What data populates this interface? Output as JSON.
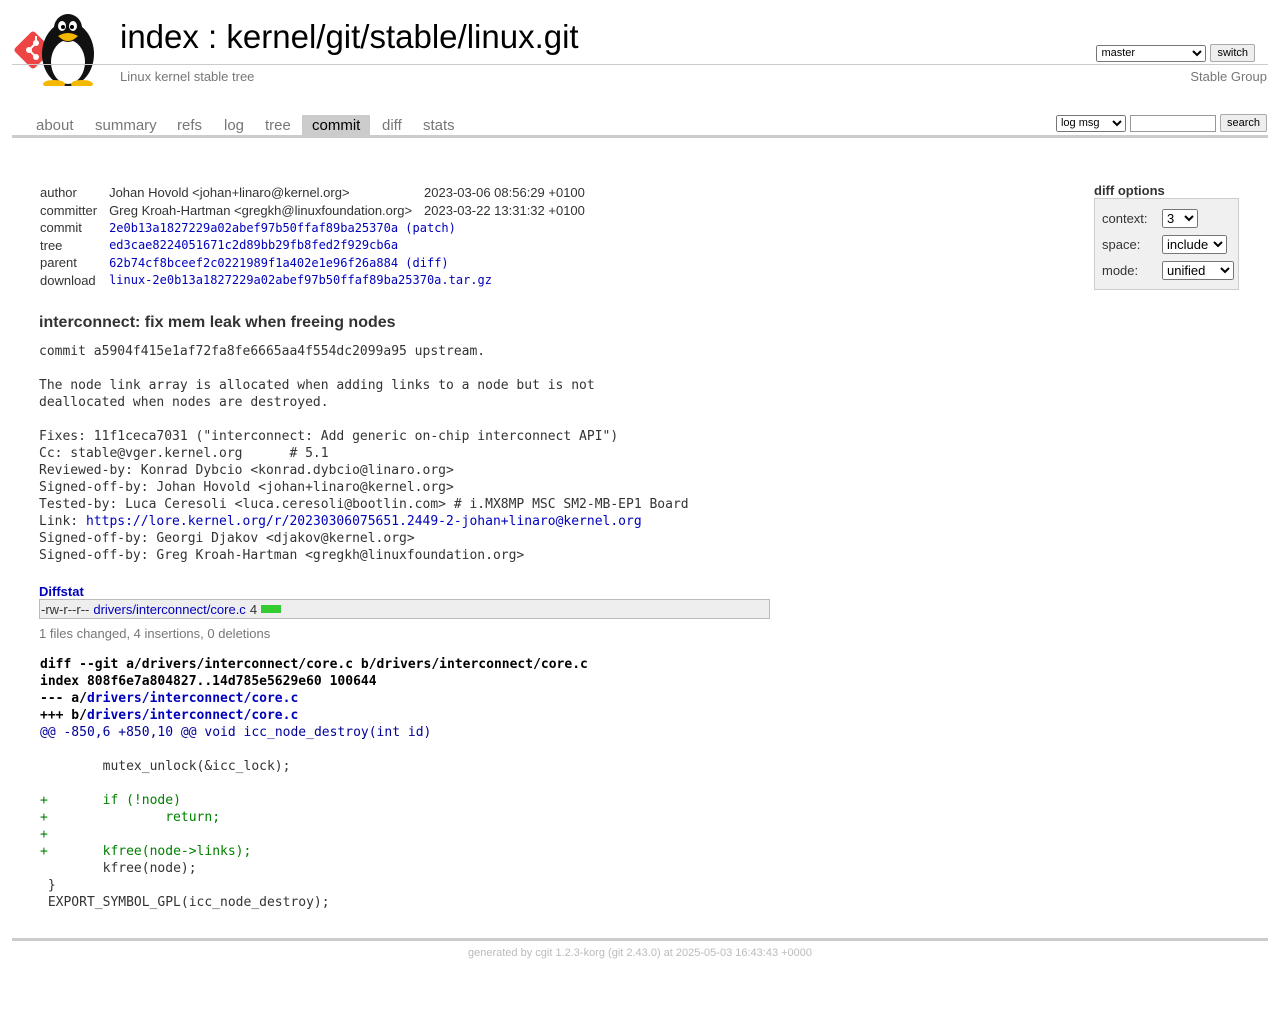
{
  "header": {
    "title_prefix": "index",
    "title_separator": " : ",
    "title_repo": "kernel/git/stable/linux.git",
    "subtitle": "Linux kernel stable tree",
    "owner": "Stable Group",
    "branch_selected": "master",
    "switch_label": "switch"
  },
  "tabs": [
    "about",
    "summary",
    "refs",
    "log",
    "tree",
    "commit",
    "diff",
    "stats"
  ],
  "active_tab": "commit",
  "search": {
    "mode": "log msg",
    "button": "search"
  },
  "commit_info": {
    "author_label": "author",
    "author": "Johan Hovold <johan+linaro@kernel.org>",
    "author_date": "2023-03-06 08:56:29 +0100",
    "committer_label": "committer",
    "committer": "Greg Kroah-Hartman <gregkh@linuxfoundation.org>",
    "committer_date": "2023-03-22 13:31:32 +0100",
    "commit_label": "commit",
    "commit": "2e0b13a1827229a02abef97b50ffaf89ba25370a",
    "patch_label": "patch",
    "tree_label": "tree",
    "tree": "ed3cae8224051671c2d89bb29fb8fed2f929cb6a",
    "parent_label": "parent",
    "parent": "62b74cf8bceef2c0221989f1a402e1e96f26a884",
    "diff_label": "diff",
    "download_label": "download",
    "download": "linux-2e0b13a1827229a02abef97b50ffaf89ba25370a.tar.gz"
  },
  "diff_options": {
    "title": "diff options",
    "context_label": "context:",
    "context_value": "3",
    "space_label": "space:",
    "space_value": "include",
    "mode_label": "mode:",
    "mode_value": "unified"
  },
  "commit_subject": "interconnect: fix mem leak when freeing nodes",
  "commit_message": {
    "body_before_link": "commit a5904f415e1af72fa8fe6665aa4f554dc2099a95 upstream.\n\nThe node link array is allocated when adding links to a node but is not\ndeallocated when nodes are destroyed.\n\nFixes: 11f1ceca7031 (\"interconnect: Add generic on-chip interconnect API\")\nCc: stable@vger.kernel.org      # 5.1\nReviewed-by: Konrad Dybcio <konrad.dybcio@linaro.org>\nSigned-off-by: Johan Hovold <johan+linaro@kernel.org>\nTested-by: Luca Ceresoli <luca.ceresoli@bootlin.com> # i.MX8MP MSC SM2-MB-EP1 Board\nLink: ",
    "link": "https://lore.kernel.org/r/20230306075651.2449-2-johan+linaro@kernel.org",
    "body_after_link": "\nSigned-off-by: Georgi Djakov <djakov@kernel.org>\nSigned-off-by: Greg Kroah-Hartman <gregkh@linuxfoundation.org>"
  },
  "diffstat": {
    "header": "Diffstat",
    "mode": "-rw-r--r--",
    "file": "drivers/interconnect/core.c",
    "count": "4",
    "summary": "1 files changed, 4 insertions, 0 deletions"
  },
  "diff": {
    "line1": "diff --git a/drivers/interconnect/core.c b/drivers/interconnect/core.c",
    "line2": "index 808f6e7a804827..14d785e5629e60 100644",
    "line3_prefix": "--- a/",
    "line3_file": "drivers/interconnect/core.c",
    "line4_prefix": "+++ b/",
    "line4_file": "drivers/interconnect/core.c",
    "hunk_header": "@@ -850,6 +850,10 @@",
    "hunk_context": " void icc_node_destroy(int id)",
    "lines": [
      {
        "type": "ctx",
        "text": " "
      },
      {
        "type": "ctx",
        "text": " \tmutex_unlock(&icc_lock);"
      },
      {
        "type": "ctx",
        "text": " "
      },
      {
        "type": "add",
        "text": "+\tif (!node)"
      },
      {
        "type": "add",
        "text": "+\t\treturn;"
      },
      {
        "type": "add",
        "text": "+"
      },
      {
        "type": "add",
        "text": "+\tkfree(node->links);"
      },
      {
        "type": "ctx",
        "text": " \tkfree(node);"
      },
      {
        "type": "ctx",
        "text": " }"
      },
      {
        "type": "ctx",
        "text": " EXPORT_SYMBOL_GPL(icc_node_destroy);"
      }
    ]
  },
  "footer": {
    "prefix": "generated by ",
    "cgit_link": "cgit 1.2.3-korg",
    "middle": " (",
    "git_link": "git 2.43.0",
    "suffix": ") at 2025-05-03 16:43:43 +0000"
  },
  "colors": {
    "link": "#0000bb",
    "added": "#008000",
    "hunk": "#000099",
    "diffstat_bar": "#33cc33"
  }
}
